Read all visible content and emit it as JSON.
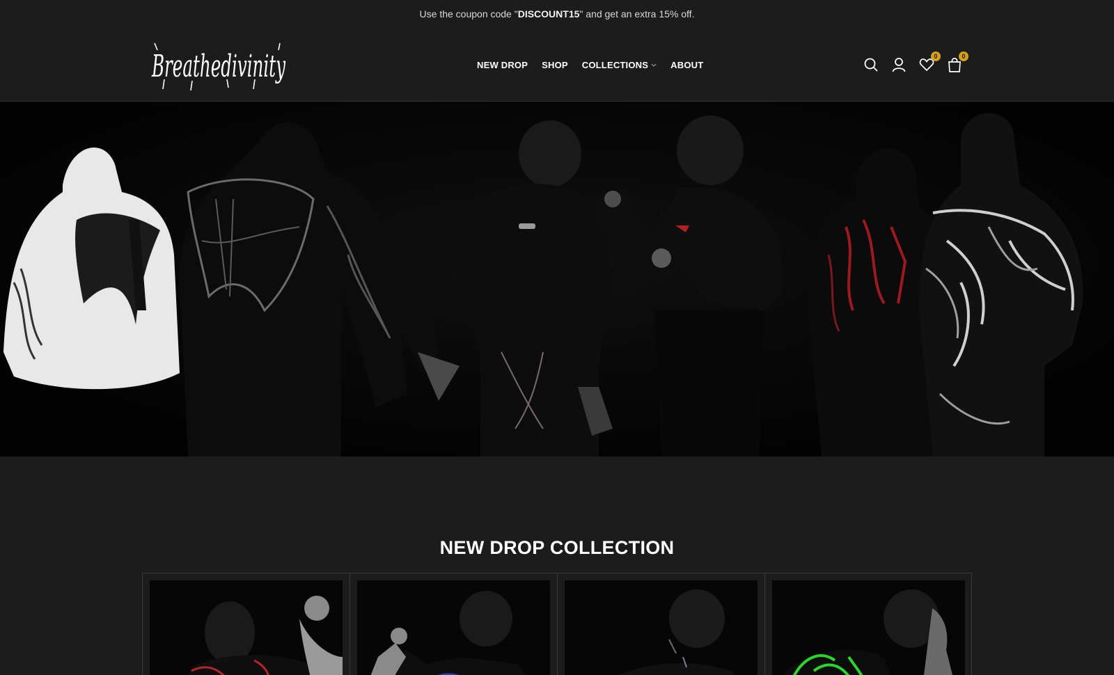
{
  "promo": {
    "prefix": "Use the coupon code \"",
    "code": "DISCOUNT15",
    "suffix": "\" and get an extra 15% off."
  },
  "header": {
    "logo_text": "Breathedivinity",
    "nav": [
      {
        "label": "NEW DROP"
      },
      {
        "label": "SHOP"
      },
      {
        "label": "COLLECTIONS"
      },
      {
        "label": "ABOUT"
      }
    ],
    "icons": {
      "search": "search-icon",
      "account": "user-icon",
      "wishlist": "heart-icon",
      "cart": "shopping-bag-icon"
    },
    "wishlist_count": "0",
    "cart_count": "0",
    "badge_color": "#d4a017"
  },
  "section": {
    "title": "NEW DROP COLLECTION"
  },
  "products": [
    {
      "accent": "#b3262b"
    },
    {
      "accent": "#2a3fa0"
    },
    {
      "accent": "#7a7a9a"
    },
    {
      "accent": "#2bd62b"
    }
  ]
}
